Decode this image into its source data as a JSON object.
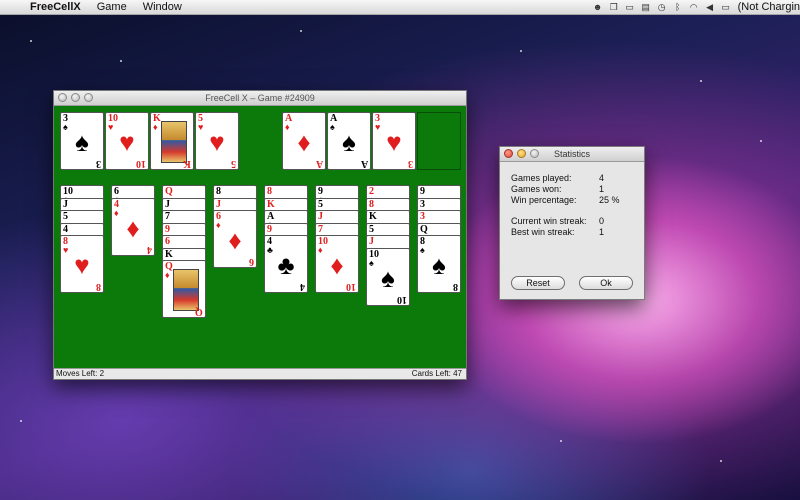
{
  "menubar": {
    "app_name": "FreeCellX",
    "menus": [
      "Game",
      "Window"
    ],
    "status_text": "(Not Chargin"
  },
  "game_window": {
    "title": "FreeCell X – Game #24909",
    "moves_left": "Moves Left: 2",
    "cards_left": "Cards Left: 47"
  },
  "free_cells": [
    {
      "rank": "3",
      "suit": "♠",
      "color": "black"
    },
    {
      "rank": "10",
      "suit": "♥",
      "color": "red"
    },
    {
      "rank": "K",
      "suit": "♦",
      "color": "red",
      "face": true
    },
    {
      "rank": "5",
      "suit": "♥",
      "color": "red"
    }
  ],
  "foundations": [
    {
      "rank": "A",
      "suit": "♦",
      "color": "red"
    },
    {
      "rank": "A",
      "suit": "♠",
      "color": "black"
    },
    {
      "rank": "3",
      "suit": "♥",
      "color": "red"
    },
    {
      "empty": true
    }
  ],
  "tableau": [
    [
      {
        "rank": "10",
        "suit": "♣",
        "color": "black"
      },
      {
        "rank": "J",
        "suit": "♠",
        "color": "black"
      },
      {
        "rank": "5",
        "suit": "♠",
        "color": "black"
      },
      {
        "rank": "4",
        "suit": "♠",
        "color": "black"
      },
      {
        "rank": "8",
        "suit": "♥",
        "color": "red"
      }
    ],
    [
      {
        "rank": "6",
        "suit": "♣",
        "color": "black"
      },
      {
        "rank": "4",
        "suit": "♦",
        "color": "red"
      }
    ],
    [
      {
        "rank": "Q",
        "suit": "♦",
        "color": "red"
      },
      {
        "rank": "J",
        "suit": "♣",
        "color": "black"
      },
      {
        "rank": "7",
        "suit": "♠",
        "color": "black"
      },
      {
        "rank": "9",
        "suit": "♥",
        "color": "red"
      },
      {
        "rank": "6",
        "suit": "♥",
        "color": "red"
      },
      {
        "rank": "K",
        "suit": "♠",
        "color": "black"
      },
      {
        "rank": "Q",
        "suit": "♦",
        "color": "red",
        "face": true
      }
    ],
    [
      {
        "rank": "8",
        "suit": "♠",
        "color": "black"
      },
      {
        "rank": "J",
        "suit": "♦",
        "color": "red"
      },
      {
        "rank": "6",
        "suit": "♦",
        "color": "red"
      }
    ],
    [
      {
        "rank": "8",
        "suit": "♦",
        "color": "red"
      },
      {
        "rank": "K",
        "suit": "♥",
        "color": "red"
      },
      {
        "rank": "A",
        "suit": "♣",
        "color": "black"
      },
      {
        "rank": "9",
        "suit": "♥",
        "color": "red"
      },
      {
        "rank": "4",
        "suit": "♣",
        "color": "black"
      }
    ],
    [
      {
        "rank": "9",
        "suit": "♣",
        "color": "black"
      },
      {
        "rank": "5",
        "suit": "♣",
        "color": "black"
      },
      {
        "rank": "J",
        "suit": "♥",
        "color": "red"
      },
      {
        "rank": "7",
        "suit": "♥",
        "color": "red"
      },
      {
        "rank": "10",
        "suit": "♦",
        "color": "red"
      }
    ],
    [
      {
        "rank": "2",
        "suit": "♦",
        "color": "red"
      },
      {
        "rank": "8",
        "suit": "♥",
        "color": "red"
      },
      {
        "rank": "K",
        "suit": "♠",
        "color": "black"
      },
      {
        "rank": "5",
        "suit": "♠",
        "color": "black"
      },
      {
        "rank": "J",
        "suit": "♦",
        "color": "red"
      },
      {
        "rank": "10",
        "suit": "♠",
        "color": "black"
      }
    ],
    [
      {
        "rank": "9",
        "suit": "♠",
        "color": "black"
      },
      {
        "rank": "3",
        "suit": "♣",
        "color": "black"
      },
      {
        "rank": "3",
        "suit": "♦",
        "color": "red"
      },
      {
        "rank": "Q",
        "suit": "♠",
        "color": "black"
      },
      {
        "rank": "8",
        "suit": "♠",
        "color": "black"
      }
    ]
  ],
  "stats_window": {
    "title": "Statistics",
    "games_played_label": "Games played:",
    "games_played": "4",
    "games_won_label": "Games won:",
    "games_won": "1",
    "win_pct_label": "Win percentage:",
    "win_pct": "25 %",
    "cur_streak_label": "Current win streak:",
    "cur_streak": "0",
    "best_streak_label": "Best win streak:",
    "best_streak": "1",
    "reset_label": "Reset",
    "ok_label": "Ok"
  },
  "colors": {
    "felt": "#0b7a0b",
    "red_suit": "#e01e1e"
  }
}
